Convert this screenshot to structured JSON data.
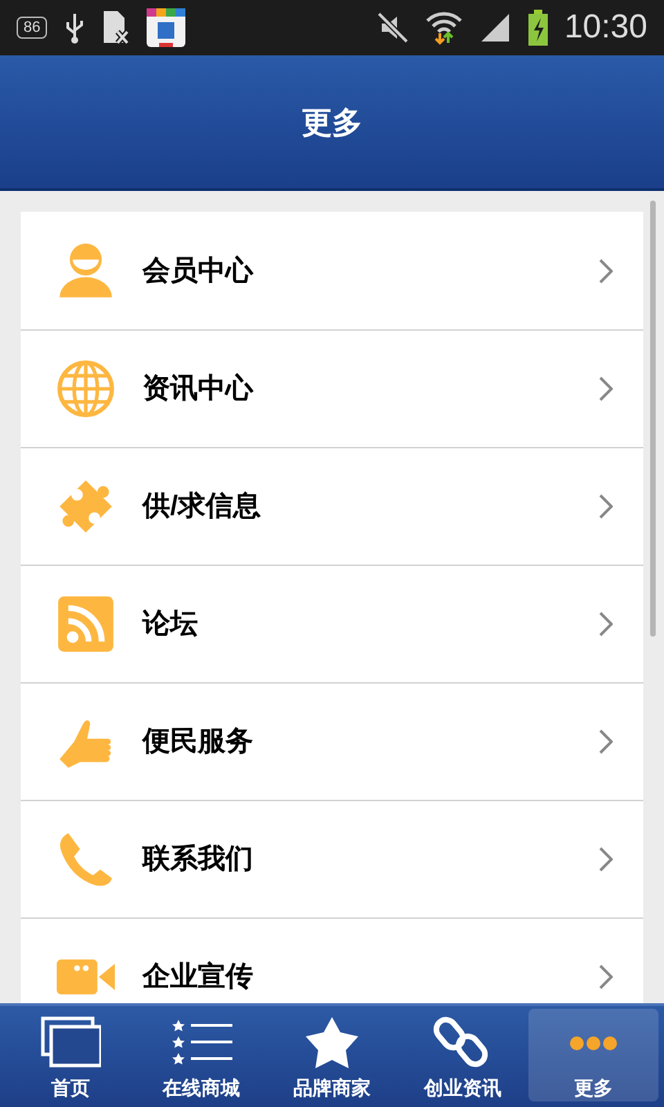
{
  "status_bar": {
    "badge": "86",
    "time": "10:30"
  },
  "header": {
    "title": "更多"
  },
  "menu": [
    {
      "label": "会员中心"
    },
    {
      "label": "资讯中心"
    },
    {
      "label": "供/求信息"
    },
    {
      "label": "论坛"
    },
    {
      "label": "便民服务"
    },
    {
      "label": "联系我们"
    },
    {
      "label": "企业宣传"
    }
  ],
  "tab_bar": [
    {
      "label": "首页",
      "selected": false
    },
    {
      "label": "在线商城",
      "selected": false
    },
    {
      "label": "品牌商家",
      "selected": false
    },
    {
      "label": "创业资讯",
      "selected": false
    },
    {
      "label": "更多",
      "selected": true
    }
  ]
}
